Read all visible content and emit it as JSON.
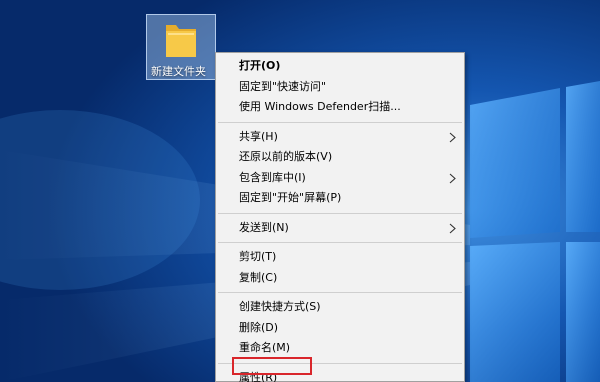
{
  "desktop": {
    "folder_label": "新建文件夹",
    "folder_color": "#f5c542"
  },
  "menu": {
    "items": [
      {
        "label": "打开(O)",
        "bold": true
      },
      {
        "label": "固定到\"快速访问\""
      },
      {
        "label": "使用 Windows Defender扫描..."
      },
      {
        "label": "共享(H)",
        "submenu": true
      },
      {
        "label": "还原以前的版本(V)"
      },
      {
        "label": "包含到库中(I)",
        "submenu": true
      },
      {
        "label": "固定到\"开始\"屏幕(P)"
      },
      {
        "label": "发送到(N)",
        "submenu": true
      },
      {
        "label": "剪切(T)"
      },
      {
        "label": "复制(C)"
      },
      {
        "label": "创建快捷方式(S)"
      },
      {
        "label": "删除(D)"
      },
      {
        "label": "重命名(M)"
      },
      {
        "label": "属性(R)",
        "highlighted": true
      }
    ],
    "highlight_color": "#d9262b"
  }
}
